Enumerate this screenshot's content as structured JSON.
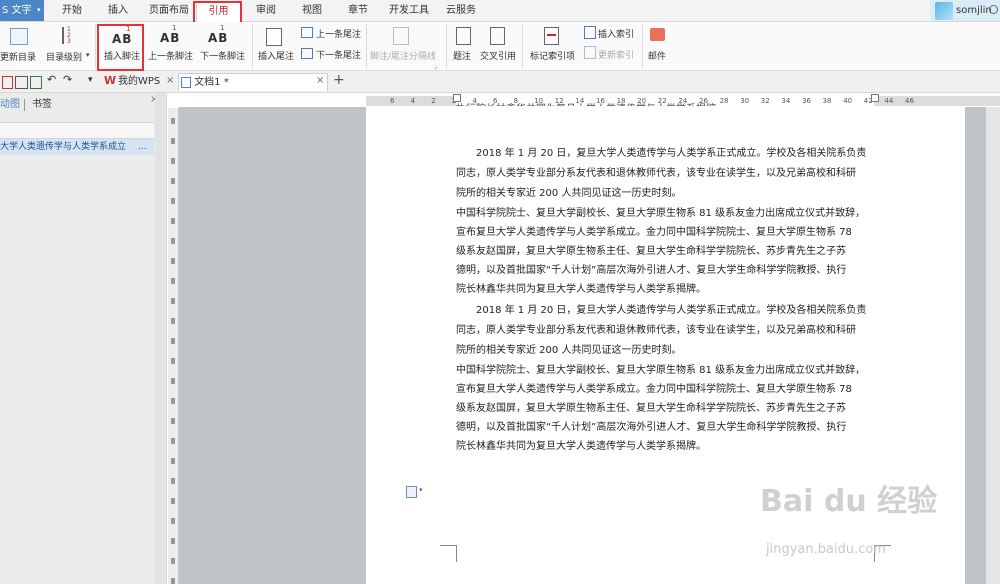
{
  "menubar": {
    "app_label": "S 文字",
    "items": [
      "开始",
      "插入",
      "页面布局",
      "引用",
      "审阅",
      "视图",
      "章节",
      "开发工具",
      "云服务"
    ],
    "active_index": 3,
    "username": "somjlin"
  },
  "ribbon": {
    "update_toc": "更新目录",
    "toc_level": "目录级别",
    "insert_footnote": "插入脚注",
    "prev_footnote": "上一条脚注",
    "next_footnote": "下一条脚注",
    "insert_endnote": "插入尾注",
    "prev_endnote": "上一条尾注",
    "next_endnote": "下一条尾注",
    "footnote_separator": "脚注/尾注分隔线",
    "caption": "题注",
    "cross_reference": "交叉引用",
    "mark_index": "标记索引项",
    "insert_index": "插入索引",
    "update_index": "更新索引",
    "mail": "邮件"
  },
  "tabs": {
    "my_wps": "我的WPS",
    "document": "文档1 *",
    "new_tab": "+"
  },
  "nav": {
    "tab_outline": "动图",
    "tab_bookmark": "书签",
    "item": "大学人类遗传学与人类学系成立",
    "more": "..."
  },
  "ruler": {
    "labels": [
      "6",
      "4",
      "2",
      "2",
      "4",
      "6",
      "8",
      "10",
      "12",
      "14",
      "16",
      "18",
      "20",
      "22",
      "24",
      "26",
      "28",
      "30",
      "32",
      "34",
      "36",
      "38",
      "40",
      "42",
      "44",
      "46"
    ]
  },
  "document": {
    "top_fragment": "执行院长林鑫华共同为复旦大学人类遗传学与人类学系揭牌。",
    "block1": [
      "2018 年 1 月 20 日，复旦大学人类遗传学与人类学系正式成立。学校及各相关院系负责",
      "同志，原人类学专业部分系友代表和退休教师代表，该专业在读学生，以及兄弟高校和科研",
      "院所的相关专家近 200 人共同见证这一历史时刻。",
      "中国科学院院士、复旦大学副校长、复旦大学原生物系 81 级系友金力出席成立仪式并致辞，",
      "宣布复旦大学人类遗传学与人类学系成立。金力同中国科学院院士、复旦大学原生物系 78",
      "级系友赵国屏，复旦大学原生物系主任、复旦大学生命科学学院院长、苏步青先生之子苏",
      "德明，以及首批国家“千人计划”高层次海外引进人才、复旦大学生命科学学院教授、执行",
      "院长林鑫华共同为复旦大学人类遗传学与人类学系揭牌。"
    ],
    "block2": [
      "2018 年 1 月 20 日，复旦大学人类遗传学与人类学系正式成立。学校及各相关院系负责",
      "同志，原人类学专业部分系友代表和退休教师代表，该专业在读学生，以及兄弟高校和科研",
      "院所的相关专家近 200 人共同见证这一历史时刻。",
      "中国科学院院士、复旦大学副校长、复旦大学原生物系 81 级系友金力出席成立仪式并致辞，",
      "宣布复旦大学人类遗传学与人类学系成立。金力同中国科学院院士、复旦大学原生物系 78",
      "级系友赵国屏，复旦大学原生物系主任、复旦大学生命科学学院院长、苏步青先生之子苏",
      "德明，以及首批国家“千人计划”高层次海外引进人才、复旦大学生命科学学院教授、执行",
      "院长林鑫华共同为复旦大学人类遗传学与人类学系揭牌。"
    ]
  },
  "watermark": {
    "main": "Bai du 经验",
    "sub": "jingyan.baidu.com"
  },
  "colors": {
    "accent_red": "#e53238",
    "app_blue": "#4a86c8",
    "canvas": "#bfc4c9"
  }
}
